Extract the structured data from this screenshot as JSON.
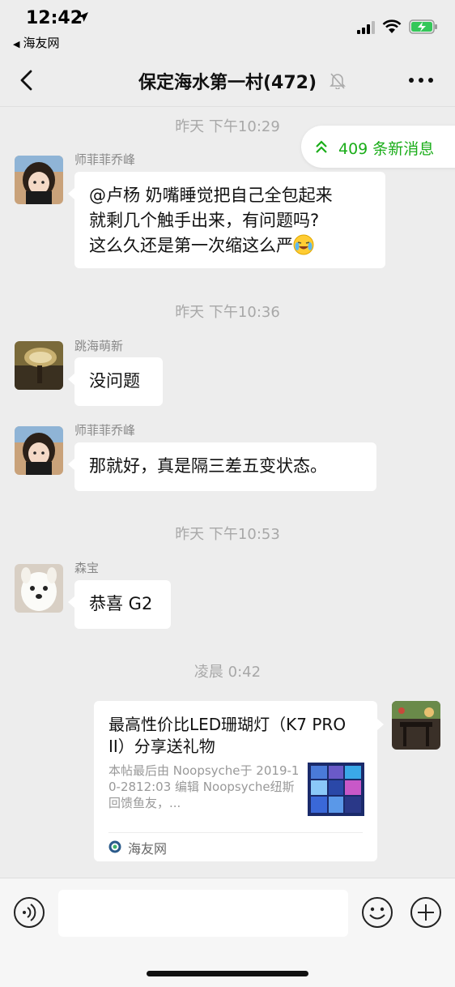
{
  "status_bar": {
    "time": "12:42",
    "back_app": "海友网",
    "icons": [
      "location-arrow-icon",
      "signal-icon",
      "wifi-icon",
      "battery-charging-icon"
    ]
  },
  "nav": {
    "title": "保定海水第一村(472)",
    "icons": [
      "back-chevron-icon",
      "mute-bell-icon",
      "more-dots-icon"
    ]
  },
  "new_messages": {
    "label": "409 条新消息",
    "icon": "double-chevron-up-icon",
    "color": "#1aad19"
  },
  "timestamps": [
    "昨天 下午10:29",
    "昨天 下午10:36",
    "昨天 下午10:53",
    "凌晨 0:42"
  ],
  "messages": [
    {
      "sender": "师菲菲乔峰",
      "lines": [
        "@卢杨 奶嘴睡觉把自己全包起来",
        "就剩几个触手出来，有问题吗?",
        "这么久还是第一次缩这么严"
      ],
      "emoji": "crying-laughing-emoji"
    },
    {
      "sender": "跳海萌新",
      "text": "没问题"
    },
    {
      "sender": "师菲菲乔峰",
      "text": "那就好，真是隔三差五变状态。"
    },
    {
      "sender": "森宝",
      "text": "恭喜 G2"
    }
  ],
  "link_card": {
    "title": "最高性价比LED珊瑚灯（K7 PRO II）分享送礼物",
    "description": "本帖最后由 Noopsyche于 2019-10-2812:03 编辑 Noopsyche纽斯回馈鱼友，...",
    "source": "海友网"
  },
  "input_bar": {
    "placeholder": "",
    "icons": [
      "voice-icon",
      "emoji-icon",
      "plus-icon"
    ]
  },
  "colors": {
    "background": "#ededed",
    "accent_green": "#1aad19",
    "bubble": "#ffffff"
  }
}
